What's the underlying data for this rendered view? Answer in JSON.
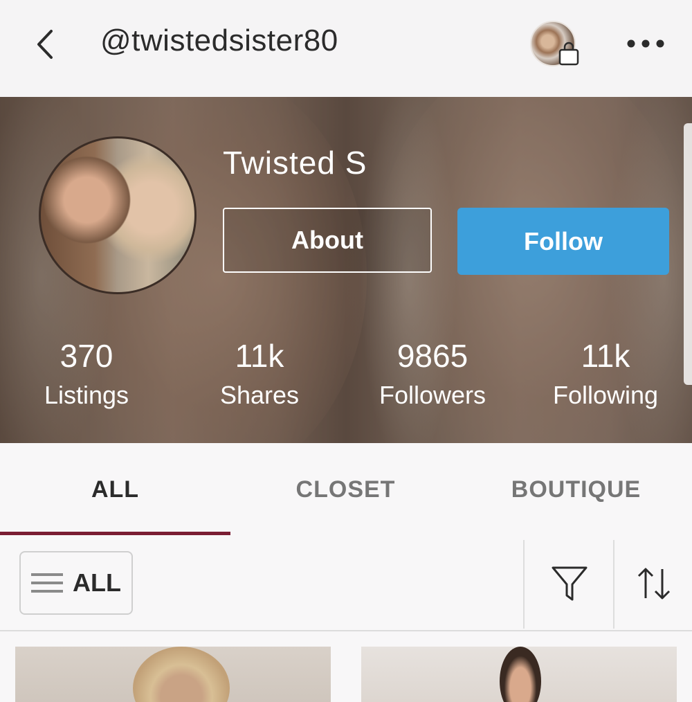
{
  "header": {
    "handle": "@twistedsister80",
    "back_icon": "chevron-left-icon",
    "bag_icon": "shopping-bag-icon",
    "more_icon": "more-horizontal-icon"
  },
  "profile": {
    "display_name": "Twisted S",
    "about_label": "About",
    "follow_label": "Follow",
    "follow_color": "#3d9fdb",
    "stats": [
      {
        "value": "370",
        "label": "Listings"
      },
      {
        "value": "11k",
        "label": "Shares"
      },
      {
        "value": "9865",
        "label": "Followers"
      },
      {
        "value": "11k",
        "label": "Following"
      }
    ]
  },
  "tabs": {
    "items": [
      {
        "label": "ALL",
        "active": true
      },
      {
        "label": "CLOSET",
        "active": false
      },
      {
        "label": "BOUTIQUE",
        "active": false
      }
    ],
    "indicator_color": "#7b1e33"
  },
  "filter_bar": {
    "category_label": "ALL",
    "filter_icon": "funnel-icon",
    "sort_icon": "sort-arrows-icon"
  }
}
